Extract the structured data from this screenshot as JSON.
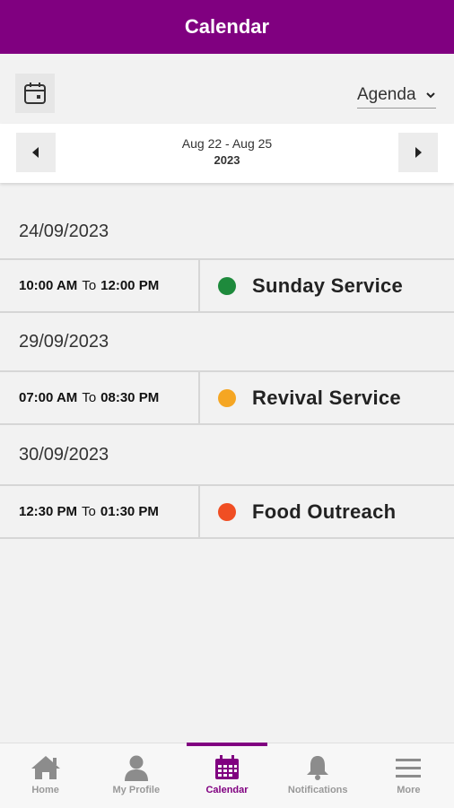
{
  "header": {
    "title": "Calendar"
  },
  "toolbar": {
    "view_selected": "Agenda"
  },
  "date_nav": {
    "range": "Aug 22 - Aug 25",
    "year": "2023"
  },
  "agenda": [
    {
      "date": "24/09/2023",
      "events": [
        {
          "start": "10:00 AM",
          "to": "To",
          "end": "12:00 PM",
          "title": "Sunday Service",
          "color": "#1e8a3c"
        }
      ]
    },
    {
      "date": "29/09/2023",
      "events": [
        {
          "start": "07:00 AM",
          "to": "To",
          "end": "08:30 PM",
          "title": "Revival Service",
          "color": "#f5a623"
        }
      ]
    },
    {
      "date": "30/09/2023",
      "events": [
        {
          "start": "12:30 PM",
          "to": "To",
          "end": "01:30 PM",
          "title": "Food Outreach",
          "color": "#f04e23"
        }
      ]
    }
  ],
  "bottom_nav": [
    {
      "label": "Home",
      "icon": "home-icon",
      "active": false
    },
    {
      "label": "My Profile",
      "icon": "profile-icon",
      "active": false
    },
    {
      "label": "Calendar",
      "icon": "calendar-icon",
      "active": true
    },
    {
      "label": "Notifications",
      "icon": "bell-icon",
      "active": false
    },
    {
      "label": "More",
      "icon": "menu-icon",
      "active": false
    }
  ],
  "colors": {
    "brand": "#800080",
    "inactive": "#999999"
  }
}
